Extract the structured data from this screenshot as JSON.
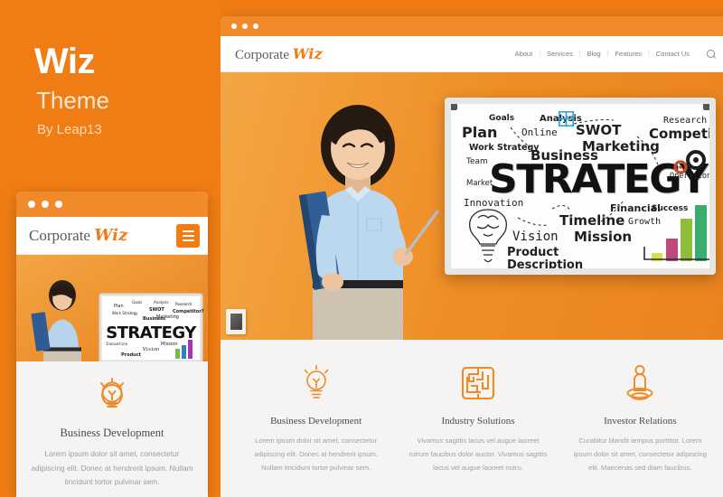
{
  "promo": {
    "title": "Wiz",
    "subtitle": "Theme",
    "author": "By Leap13",
    "brand_color": "#f07d14",
    "title_color": "#ffffff",
    "subtitle_color": "#ffe9d4"
  },
  "mobile": {
    "window_dots": [
      "dot",
      "dot",
      "dot"
    ],
    "brand_primary": "Corporate",
    "brand_accent": "Wiz",
    "menu_icon": "hamburger-icon",
    "feature": {
      "icon": "lightbulb-icon",
      "title": "Business Development",
      "text": "Lorem ipsum dolor sit amet, consectetur adipiscing elit. Donec at hendrerit ipsum. Nullam tincidunt tortor pulvinar sem."
    }
  },
  "desktop": {
    "window_dots": [
      "dot",
      "dot",
      "dot"
    ],
    "brand_primary": "Corporate",
    "brand_accent": "Wiz",
    "nav": [
      {
        "label": "About"
      },
      {
        "label": "Services"
      },
      {
        "label": "Blog"
      },
      {
        "label": "Features"
      },
      {
        "label": "Contact Us"
      }
    ],
    "nav_separator": "|",
    "search_icon": "search-icon",
    "hero": {
      "background_color": "#ef8d25",
      "person_alt": "businesswoman-photo",
      "wall_frame": "picture-frame",
      "whiteboard": {
        "headline": "STRATEGY",
        "words": [
          "Goals",
          "Analysis",
          "Research",
          "Plan",
          "Online",
          "SWOT",
          "Competitor?",
          "Work Strategy",
          "Marketing",
          "Team",
          "Business",
          "Market",
          "Operations",
          "Innovation",
          "Financial",
          "Success",
          "Growth",
          "Timeline",
          "Vision",
          "Mission",
          "Product",
          "Description"
        ],
        "chart_bars": 5
      }
    },
    "features": [
      {
        "icon": "lightbulb-icon",
        "title": "Business Development",
        "text": "Lorem ipsum dolor sit amet, consectetur adipiscing elit. Donec at hendrerit ipsum. Nullam tincidunt tortor pulvinar sem."
      },
      {
        "icon": "maze-icon",
        "title": "Industry Solutions",
        "text": "Vivamus sagittis lacus vel augue laoreet rutrum faucibus dolor auctor. Vivamus sagittis lacus vel augue laoreet nutru."
      },
      {
        "icon": "person-podium-icon",
        "title": "Investor Relations",
        "text": "Curabitur blandit tempus porttitor. Lorem ipsum dolor sit amet, consectetur adipiscing elit. Maecenas sed diam faucibus."
      }
    ]
  }
}
